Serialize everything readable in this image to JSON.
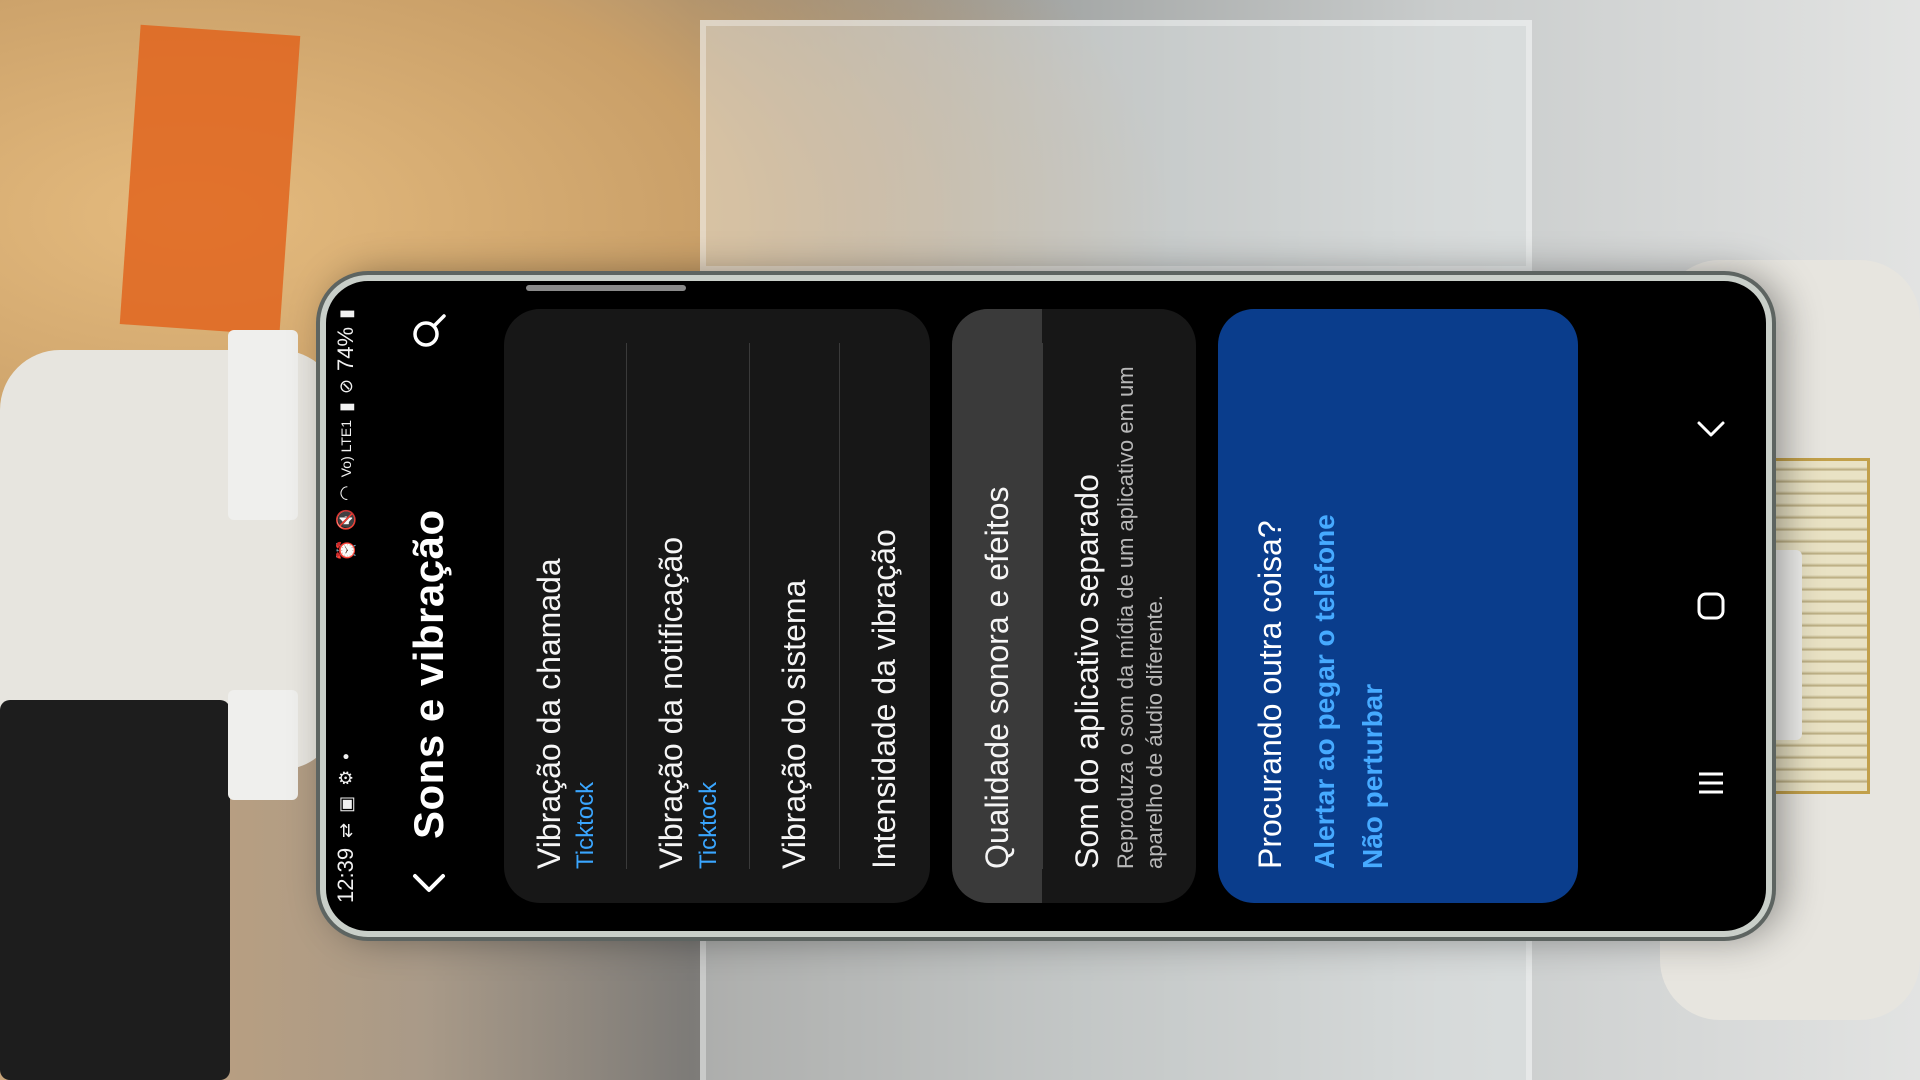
{
  "status_bar": {
    "time": "12:39",
    "battery": "74%",
    "network": "Vo) LTE1"
  },
  "header": {
    "title": "Sons e vibração"
  },
  "vibration_card": {
    "items": [
      {
        "title": "Vibração da chamada",
        "subtitle": "Ticktock"
      },
      {
        "title": "Vibração da notificação",
        "subtitle": "Ticktock"
      },
      {
        "title": "Vibração do sistema"
      },
      {
        "title": "Intensidade da vibração"
      }
    ]
  },
  "audio_card": {
    "items": [
      {
        "title": "Qualidade sonora e efeitos"
      },
      {
        "title": "Som do aplicativo separado",
        "description": "Reproduza o som da mídia de um aplicativo em um aparelho de áudio diferente."
      }
    ]
  },
  "suggestions": {
    "title": "Procurando outra coisa?",
    "links": [
      "Alertar ao pegar o telefone",
      "Não perturbar"
    ]
  },
  "colors": {
    "accent": "#3aa6ff",
    "suggest_bg": "#0a3d8c",
    "card_bg": "#171717"
  }
}
